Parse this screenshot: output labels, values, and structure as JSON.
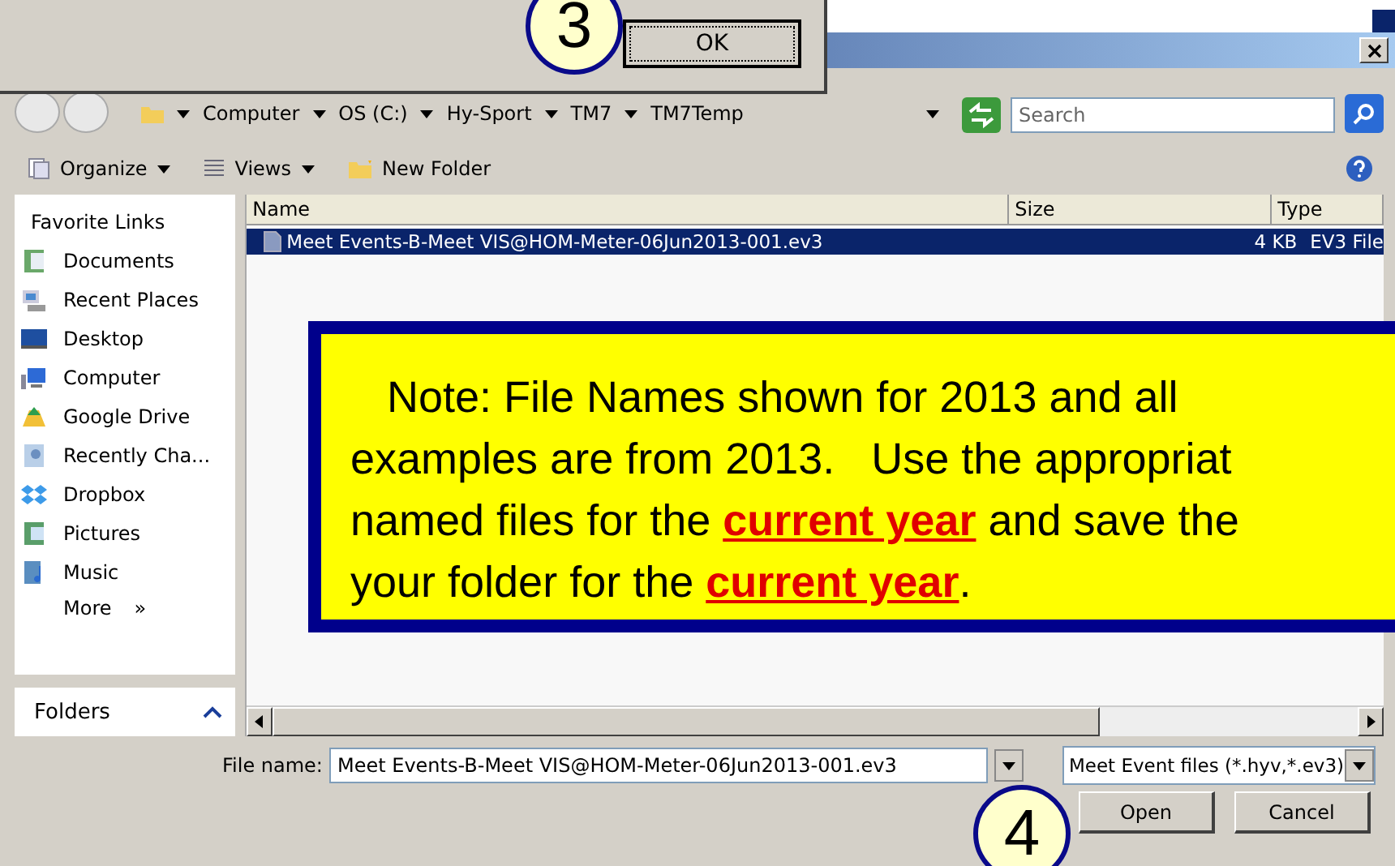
{
  "message_box": {
    "ok_button": "OK"
  },
  "callouts": [
    {
      "number": "3"
    },
    {
      "number": "4"
    }
  ],
  "address_bar": {
    "path": [
      "Computer",
      "OS (C:)",
      "Hy-Sport",
      "TM7",
      "TM7Temp"
    ]
  },
  "search": {
    "placeholder": "Search"
  },
  "toolbar": [
    {
      "label": "Organize",
      "kind": "menu"
    },
    {
      "label": "Views",
      "kind": "menu"
    },
    {
      "label": "New Folder",
      "kind": "button"
    }
  ],
  "sidebar": {
    "heading": "Favorite Links",
    "items": [
      {
        "label": "Documents"
      },
      {
        "label": "Recent Places"
      },
      {
        "label": "Desktop"
      },
      {
        "label": "Computer"
      },
      {
        "label": "Google Drive"
      },
      {
        "label": "Recently Cha..."
      },
      {
        "label": "Dropbox"
      },
      {
        "label": "Pictures"
      },
      {
        "label": "Music"
      }
    ],
    "more": "More",
    "more_glyph": "»",
    "folders": "Folders"
  },
  "file_list": {
    "columns": [
      "Name",
      "Size",
      "Type"
    ],
    "rows": [
      {
        "name": "Meet Events-B-Meet VIS@HOM-Meter-06Jun2013-001.ev3",
        "size": "4 KB",
        "type": "EV3 File",
        "selected": true
      }
    ]
  },
  "note": {
    "lines": [
      "Note: File Names shown for 2013 and all",
      "examples are from 2013.   Use the appropriat",
      "named files for the **current year** and save the",
      "your folder for the **current year**."
    ]
  },
  "file_name": {
    "label": "File name:",
    "value": "Meet Events-B-Meet VIS@HOM-Meter-06Jun2013-001.ev3"
  },
  "filter": {
    "value": "Meet Event files (*.hyv,*.ev3)"
  },
  "buttons": [
    "Open",
    "Cancel"
  ]
}
